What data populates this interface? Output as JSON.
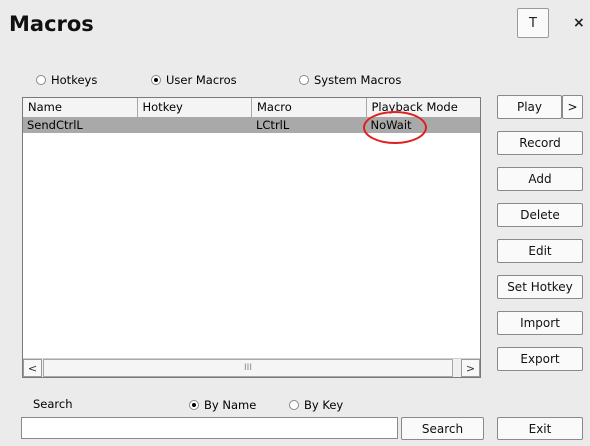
{
  "window": {
    "title": "Macros",
    "pin_label": "T",
    "close_label": "×"
  },
  "type_radios": [
    {
      "label": "Hotkeys",
      "selected": false
    },
    {
      "label": "User Macros",
      "selected": true
    },
    {
      "label": "System Macros",
      "selected": false
    }
  ],
  "table": {
    "columns": [
      "Name",
      "Hotkey",
      "Macro",
      "Playback Mode"
    ],
    "rows": [
      {
        "name": "SendCtrlL",
        "hotkey": "",
        "macro": "LCtrlL",
        "playback_mode": "NoWait",
        "selected": true
      }
    ],
    "scroll_left_label": "<",
    "scroll_right_label": ">",
    "thumb_grip": "III"
  },
  "actions": {
    "play": "Play",
    "play_more": ">",
    "record": "Record",
    "add": "Add",
    "delete": "Delete",
    "edit": "Edit",
    "set_hotkey": "Set Hotkey",
    "import": "Import",
    "export": "Export"
  },
  "search": {
    "label": "Search",
    "by_name": {
      "label": "By Name",
      "selected": true
    },
    "by_key": {
      "label": "By Key",
      "selected": false
    },
    "value": "",
    "button": "Search"
  },
  "exit_label": "Exit",
  "highlight_color": "#e0201c"
}
